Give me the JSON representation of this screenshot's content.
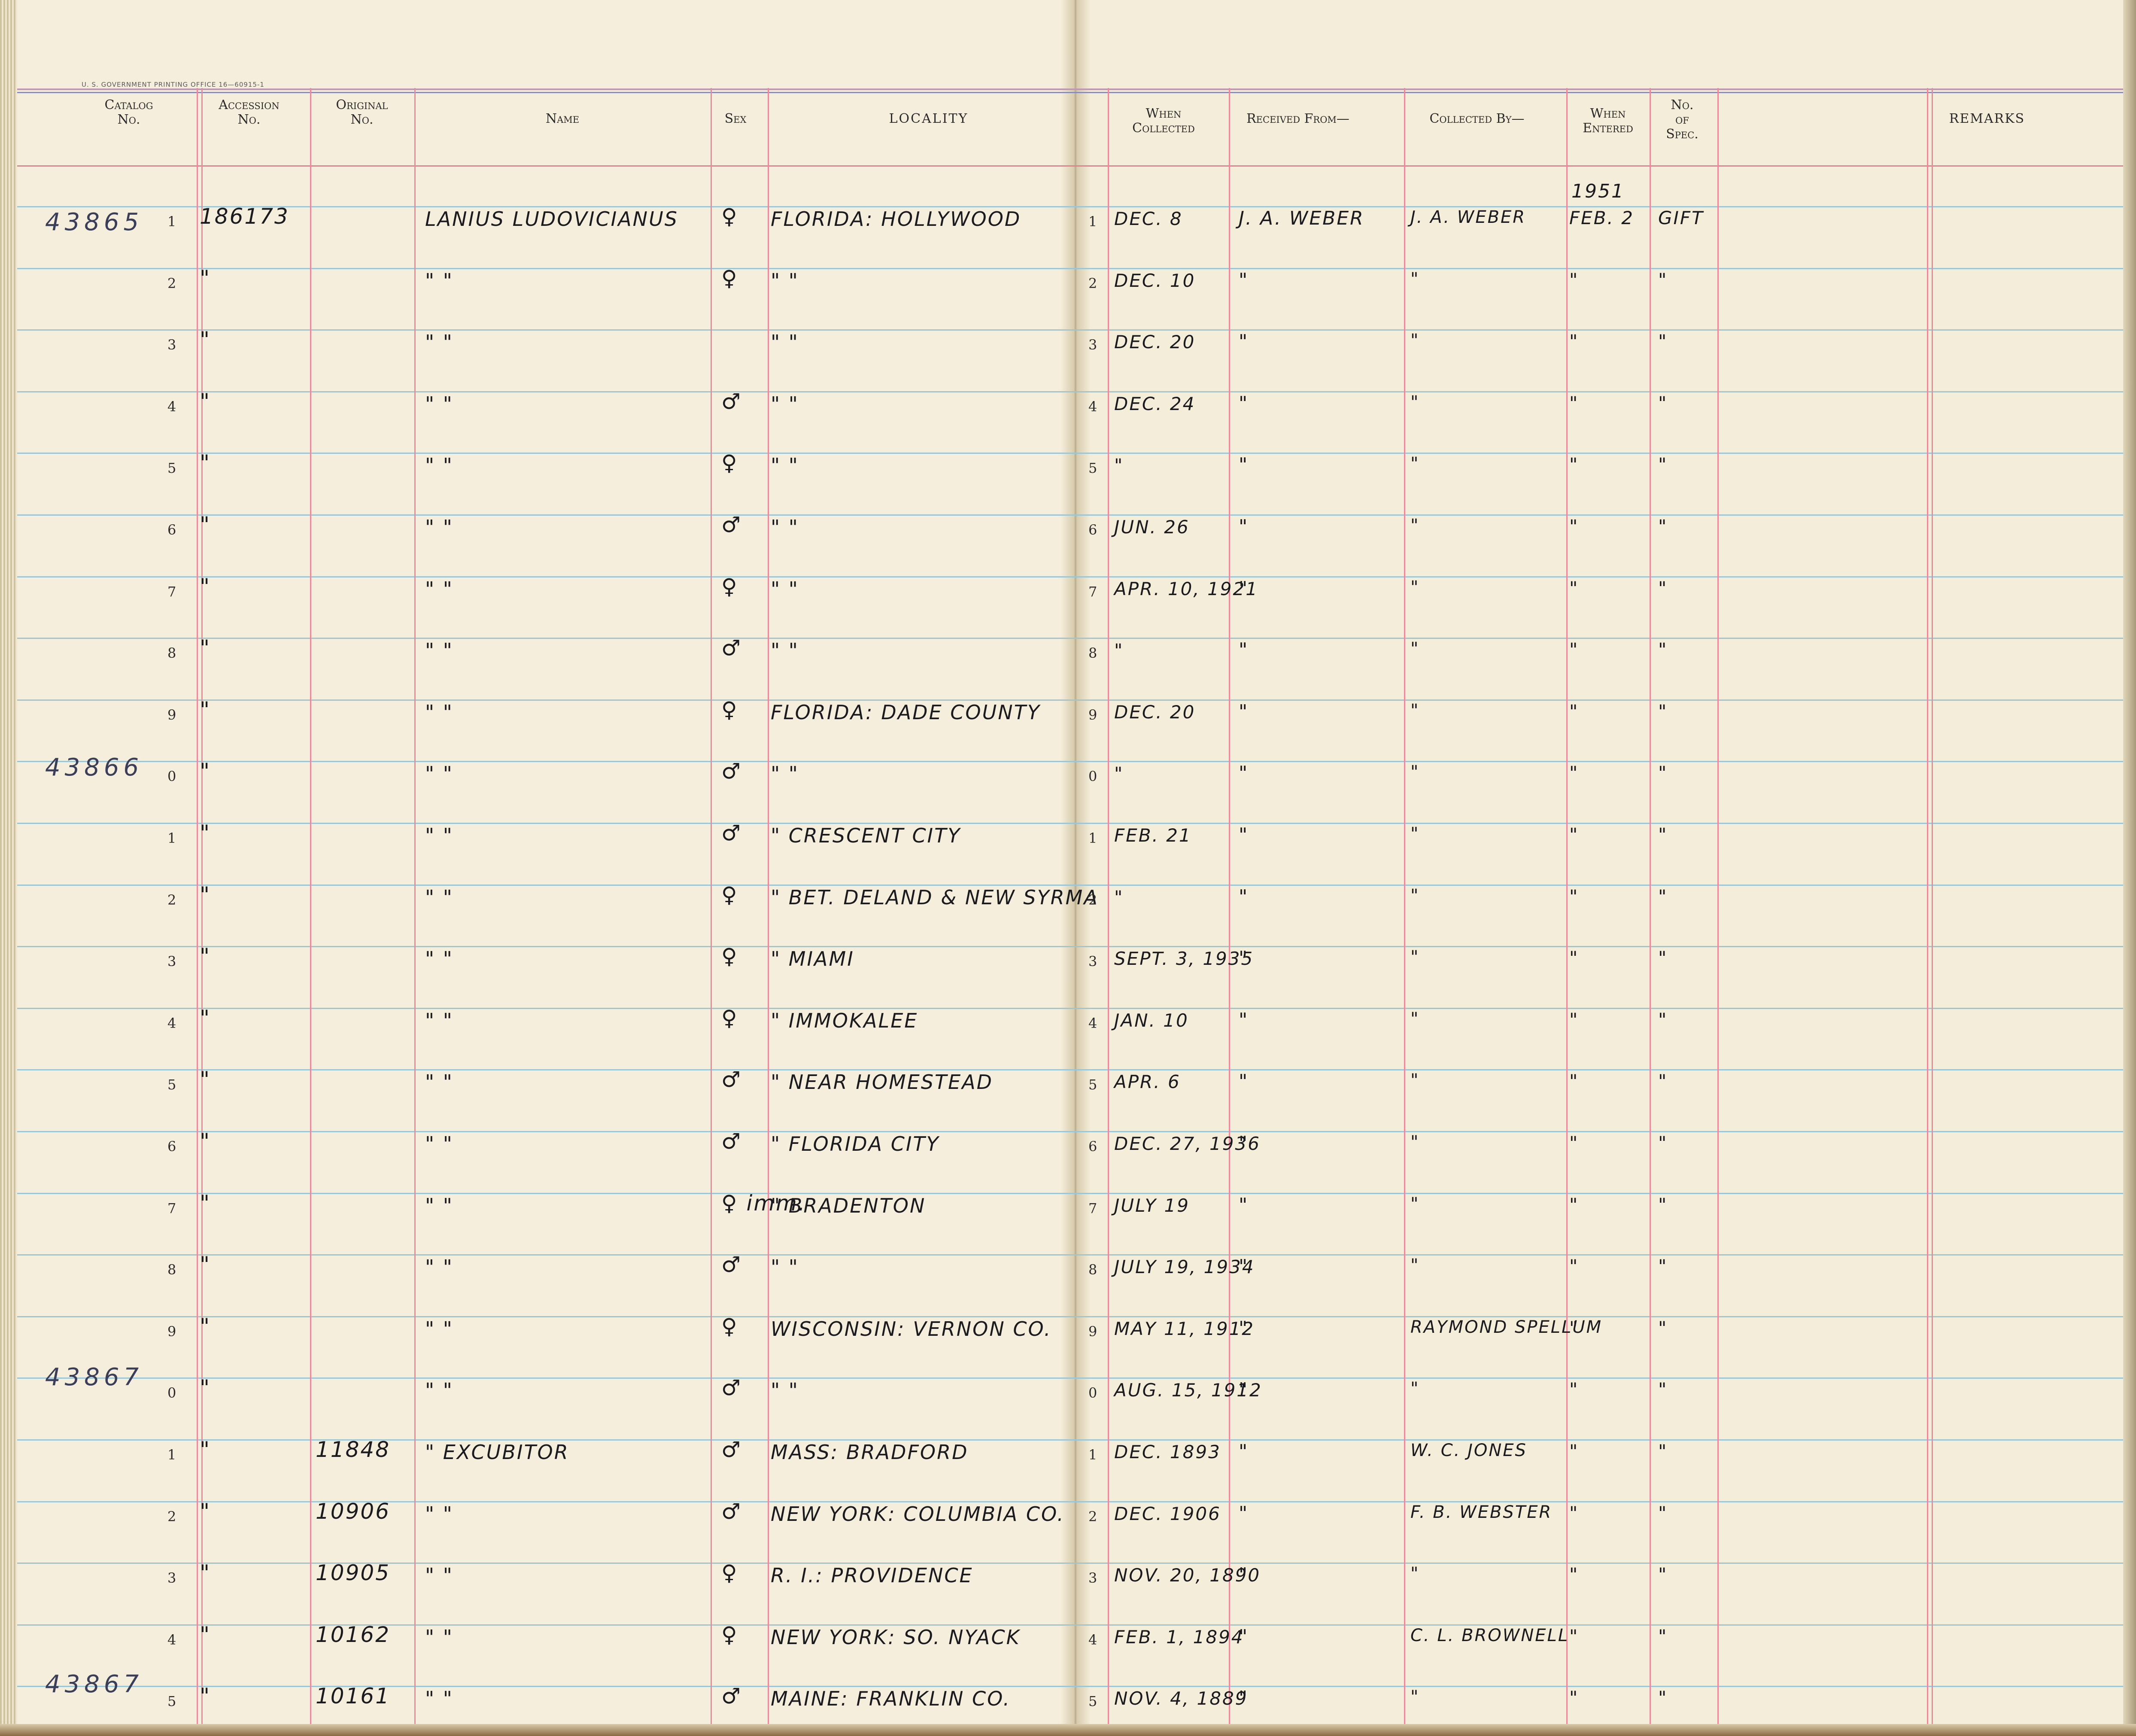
{
  "ledger": {
    "printer_note": "U. S. GOVERNMENT PRINTING OFFICE     16—60915-1",
    "left_headers": {
      "catalog": "Catalog\nNo.",
      "accession": "Accession\nNo.",
      "original": "Original\nNo.",
      "name": "Name",
      "sex": "Sex",
      "locality": "LOCALITY"
    },
    "right_headers": {
      "when_collected": "When\nCollected",
      "received_from": "Received From—",
      "collected_by": "Collected By—",
      "when_entered": "When\nEntered",
      "no_of_spec": "No.\nof\nSpec.",
      "remarks": "REMARKS"
    },
    "entered_year": "1951",
    "catalog_prefixes": [
      "43865",
      "43866",
      "43867",
      "43867"
    ],
    "rows": [
      {
        "n": "1",
        "accession": "186173",
        "original": "",
        "name": "LANIUS LUDOVICIANUS",
        "sex": "♀",
        "locality": "FLORIDA: HOLLYWOOD",
        "date": "DEC. 8",
        "received": "J. A. WEBER",
        "collected": "J. A. WEBER",
        "entered": "FEB. 2",
        "spec": "GIFT"
      },
      {
        "n": "2",
        "accession": "\"",
        "original": "",
        "name": "\"          \"",
        "sex": "♀",
        "locality": "\"          \"",
        "date": "DEC. 10",
        "received": "\"",
        "collected": "\"",
        "entered": "\"",
        "spec": "\""
      },
      {
        "n": "3",
        "accession": "\"",
        "original": "",
        "name": "\"          \"",
        "sex": "",
        "locality": "\"          \"",
        "date": "DEC. 20",
        "received": "\"",
        "collected": "\"",
        "entered": "\"",
        "spec": "\""
      },
      {
        "n": "4",
        "accession": "\"",
        "original": "",
        "name": "\"          \"",
        "sex": "♂",
        "locality": "\"          \"",
        "date": "DEC. 24",
        "received": "\"",
        "collected": "\"",
        "entered": "\"",
        "spec": "\""
      },
      {
        "n": "5",
        "accession": "\"",
        "original": "",
        "name": "\"          \"",
        "sex": "♀",
        "locality": "\"          \"",
        "date": "\"",
        "received": "\"",
        "collected": "\"",
        "entered": "\"",
        "spec": "\""
      },
      {
        "n": "6",
        "accession": "\"",
        "original": "",
        "name": "\"          \"",
        "sex": "♂",
        "locality": "\"          \"",
        "date": "JUN. 26",
        "received": "\"",
        "collected": "\"",
        "entered": "\"",
        "spec": "\""
      },
      {
        "n": "7",
        "accession": "\"",
        "original": "",
        "name": "\"          \"",
        "sex": "♀",
        "locality": "\"          \"",
        "date": "APR. 10, 1921",
        "received": "\"",
        "collected": "\"",
        "entered": "\"",
        "spec": "\""
      },
      {
        "n": "8",
        "accession": "\"",
        "original": "",
        "name": "\"          \"",
        "sex": "♂",
        "locality": "\"          \"",
        "date": "\"",
        "received": "\"",
        "collected": "\"",
        "entered": "\"",
        "spec": "\""
      },
      {
        "n": "9",
        "accession": "\"",
        "original": "",
        "name": "\"          \"",
        "sex": "♀",
        "locality": "FLORIDA: DADE COUNTY",
        "date": "DEC. 20",
        "received": "\"",
        "collected": "\"",
        "entered": "\"",
        "spec": "\""
      },
      {
        "n": "0",
        "accession": "\"",
        "original": "",
        "name": "\"          \"",
        "sex": "♂",
        "locality": "\"          \"",
        "date": "\"",
        "received": "\"",
        "collected": "\"",
        "entered": "\"",
        "spec": "\""
      },
      {
        "n": "1",
        "accession": "\"",
        "original": "",
        "name": "\"          \"",
        "sex": "♂",
        "locality": "\"   CRESCENT CITY",
        "date": "FEB. 21",
        "received": "\"",
        "collected": "\"",
        "entered": "\"",
        "spec": "\""
      },
      {
        "n": "2",
        "accession": "\"",
        "original": "",
        "name": "\"          \"",
        "sex": "♀",
        "locality": "\"  BET. DELAND & NEW SYRMA",
        "date": "\"",
        "received": "\"",
        "collected": "\"",
        "entered": "\"",
        "spec": "\""
      },
      {
        "n": "3",
        "accession": "\"",
        "original": "",
        "name": "\"          \"",
        "sex": "♀",
        "locality": "\"      MIAMI",
        "date": "SEPT. 3, 1935",
        "received": "\"",
        "collected": "\"",
        "entered": "\"",
        "spec": "\""
      },
      {
        "n": "4",
        "accession": "\"",
        "original": "",
        "name": "\"          \"",
        "sex": "♀",
        "locality": "\"   IMMOKALEE",
        "date": "JAN. 10",
        "received": "\"",
        "collected": "\"",
        "entered": "\"",
        "spec": "\""
      },
      {
        "n": "5",
        "accession": "\"",
        "original": "",
        "name": "\"          \"",
        "sex": "♂",
        "locality": "\"   NEAR HOMESTEAD",
        "date": "APR. 6",
        "received": "\"",
        "collected": "\"",
        "entered": "\"",
        "spec": "\""
      },
      {
        "n": "6",
        "accession": "\"",
        "original": "",
        "name": "\"          \"",
        "sex": "♂",
        "locality": "\"   FLORIDA CITY",
        "date": "DEC. 27, 1936",
        "received": "\"",
        "collected": "\"",
        "entered": "\"",
        "spec": "\""
      },
      {
        "n": "7",
        "accession": "\"",
        "original": "",
        "name": "\"          \"",
        "sex": "♀ imm.",
        "locality": "\"   BRADENTON",
        "date": "JULY 19",
        "received": "\"",
        "collected": "\"",
        "entered": "\"",
        "spec": "\""
      },
      {
        "n": "8",
        "accession": "\"",
        "original": "",
        "name": "\"          \"",
        "sex": "♂",
        "locality": "\"          \"",
        "date": "JULY 19, 1934",
        "received": "\"",
        "collected": "\"",
        "entered": "\"",
        "spec": "\""
      },
      {
        "n": "9",
        "accession": "\"",
        "original": "",
        "name": "\"          \"",
        "sex": "♀",
        "locality": "WISCONSIN: VERNON CO.",
        "date": "MAY 11, 1912",
        "received": "\"",
        "collected": "RAYMOND SPELLUM",
        "entered": "\"",
        "spec": "\""
      },
      {
        "n": "0",
        "accession": "\"",
        "original": "",
        "name": "\"          \"",
        "sex": "♂",
        "locality": "\"          \"",
        "date": "AUG. 15, 1912",
        "received": "\"",
        "collected": "\"",
        "entered": "\"",
        "spec": "\""
      },
      {
        "n": "1",
        "accession": "\"",
        "original": "11848",
        "name": "\"   EXCUBITOR",
        "sex": "♂",
        "locality": "MASS: BRADFORD",
        "date": "DEC. 1893",
        "received": "\"",
        "collected": "W. C. JONES",
        "entered": "\"",
        "spec": "\""
      },
      {
        "n": "2",
        "accession": "\"",
        "original": "10906",
        "name": "\"          \"",
        "sex": "♂",
        "locality": "NEW YORK: COLUMBIA CO.",
        "date": "DEC. 1906",
        "received": "\"",
        "collected": "F. B. WEBSTER",
        "entered": "\"",
        "spec": "\""
      },
      {
        "n": "3",
        "accession": "\"",
        "original": "10905",
        "name": "\"          \"",
        "sex": "♀",
        "locality": "R. I.: PROVIDENCE",
        "date": "NOV. 20, 1890",
        "received": "\"",
        "collected": "\"",
        "entered": "\"",
        "spec": "\""
      },
      {
        "n": "4",
        "accession": "\"",
        "original": "10162",
        "name": "\"          \"",
        "sex": "♀",
        "locality": "NEW YORK: SO. NYACK",
        "date": "FEB. 1, 1894",
        "received": "\"",
        "collected": "C. L. BROWNELL",
        "entered": "\"",
        "spec": "\""
      },
      {
        "n": "5",
        "accession": "\"",
        "original": "10161",
        "name": "\"          \"",
        "sex": "♂",
        "locality": "MAINE: FRANKLIN CO.",
        "date": "NOV. 4, 1889",
        "received": "\"",
        "collected": "\"",
        "entered": "\"",
        "spec": "\""
      }
    ]
  }
}
